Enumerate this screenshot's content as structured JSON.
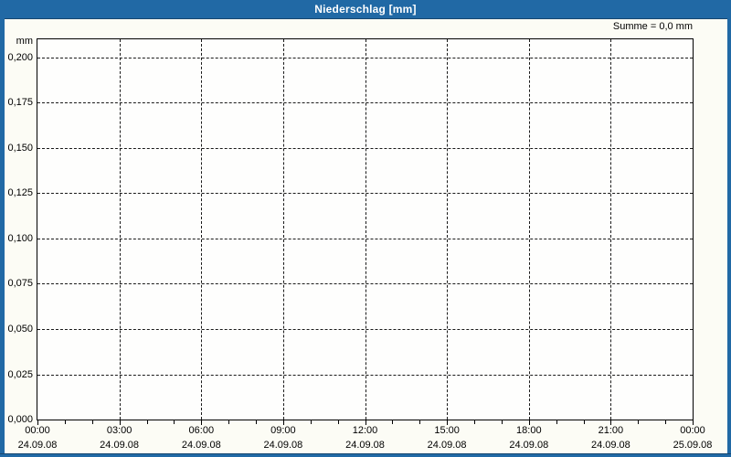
{
  "window": {
    "title": "Niederschlag [mm]"
  },
  "header": {
    "sum_label": "Summe = 0,0 mm"
  },
  "colors": {
    "titlebar": "#2169a5",
    "border": "#2169a5",
    "border_dark": "#17466f",
    "background": "#fcfcf5",
    "plot_background": "#fefefd",
    "grid": "#1a1a1a",
    "axis": "#000000",
    "text": "#000000",
    "title_text": "#ffffff"
  },
  "chart_data": {
    "type": "line",
    "title": "Niederschlag [mm]",
    "ylabel": "mm",
    "annotation": "Summe = 0,0 mm",
    "grid": "dashed",
    "series": [],
    "y_axis": {
      "min": 0,
      "max_tick": 0.2,
      "tick_step": 0.025,
      "axis_max": 0.21
    },
    "y_ticks": [
      {
        "value": 0.2,
        "label": "0,200"
      },
      {
        "value": 0.175,
        "label": "0,175"
      },
      {
        "value": 0.15,
        "label": "0,150"
      },
      {
        "value": 0.125,
        "label": "0,125"
      },
      {
        "value": 0.1,
        "label": "0,100"
      },
      {
        "value": 0.075,
        "label": "0,075"
      },
      {
        "value": 0.05,
        "label": "0,050"
      },
      {
        "value": 0.025,
        "label": "0,025"
      },
      {
        "value": 0.0,
        "label": "0,000"
      }
    ],
    "x_axis": {
      "range_hours": [
        0,
        24
      ],
      "minor_tick_every_hours": 1,
      "major_tick_every_hours": 3
    },
    "x_major_ticks": [
      {
        "hour": 0,
        "time": "00:00",
        "date": "24.09.08"
      },
      {
        "hour": 3,
        "time": "03:00",
        "date": "24.09.08"
      },
      {
        "hour": 6,
        "time": "06:00",
        "date": "24.09.08"
      },
      {
        "hour": 9,
        "time": "09:00",
        "date": "24.09.08"
      },
      {
        "hour": 12,
        "time": "12:00",
        "date": "24.09.08"
      },
      {
        "hour": 15,
        "time": "15:00",
        "date": "24.09.08"
      },
      {
        "hour": 18,
        "time": "18:00",
        "date": "24.09.08"
      },
      {
        "hour": 21,
        "time": "21:00",
        "date": "24.09.08"
      },
      {
        "hour": 24,
        "time": "00:00",
        "date": "25.09.08"
      }
    ]
  }
}
